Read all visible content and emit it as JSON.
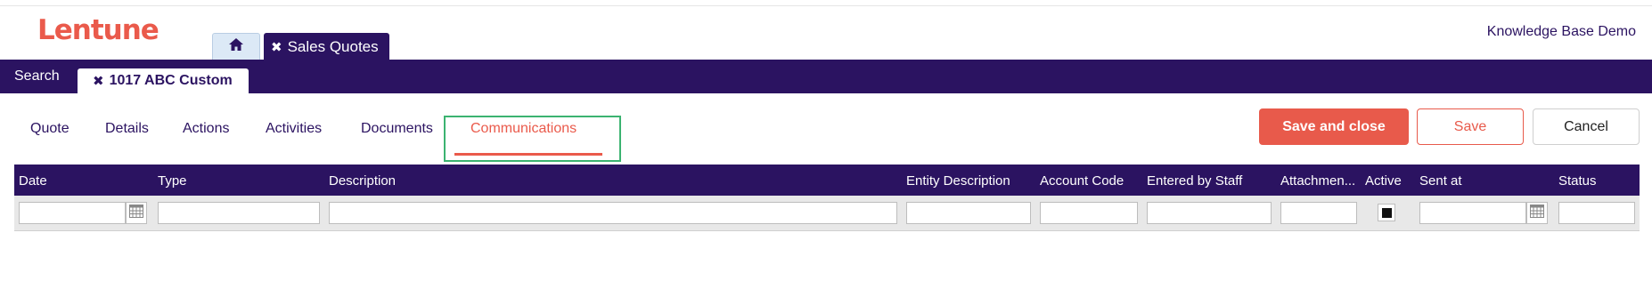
{
  "brand": {
    "logo_text": "Lentune",
    "logo_color": "#ea5a4b"
  },
  "app_tabs": [
    {
      "icon": "home-icon"
    },
    {
      "label": "Sales Quotes",
      "close_icon": "close-icon"
    }
  ],
  "top_right": {
    "label": "Knowledge Base Demo"
  },
  "navbar": {
    "search_label": "Search",
    "record_tab": {
      "label": "1017 ABC Custom",
      "close_icon": "close-icon"
    }
  },
  "subtabs": [
    {
      "label": "Quote"
    },
    {
      "label": "Details"
    },
    {
      "label": "Actions"
    },
    {
      "label": "Activities"
    },
    {
      "label": "Documents"
    },
    {
      "label": "Communications",
      "active": true
    }
  ],
  "buttons": {
    "save_and_close": "Save and close",
    "save": "Save",
    "cancel": "Cancel"
  },
  "grid": {
    "columns": [
      {
        "header": "Date",
        "filter": ""
      },
      {
        "header": "Type",
        "filter": ""
      },
      {
        "header": "Description",
        "filter": ""
      },
      {
        "header": "Entity Description",
        "filter": ""
      },
      {
        "header": "Account Code",
        "filter": ""
      },
      {
        "header": "Entered by Staff",
        "filter": ""
      },
      {
        "header": "Attachmen...",
        "filter": ""
      },
      {
        "header": "Active",
        "filter": "checked"
      },
      {
        "header": "Sent at",
        "filter": ""
      },
      {
        "header": "Status",
        "filter": ""
      }
    ],
    "rows": []
  },
  "colors": {
    "primary_dark": "#2b1361",
    "accent": "#ea5a4b",
    "focus_outline": "#3cb371",
    "home_tab_bg": "#dce9f6"
  }
}
